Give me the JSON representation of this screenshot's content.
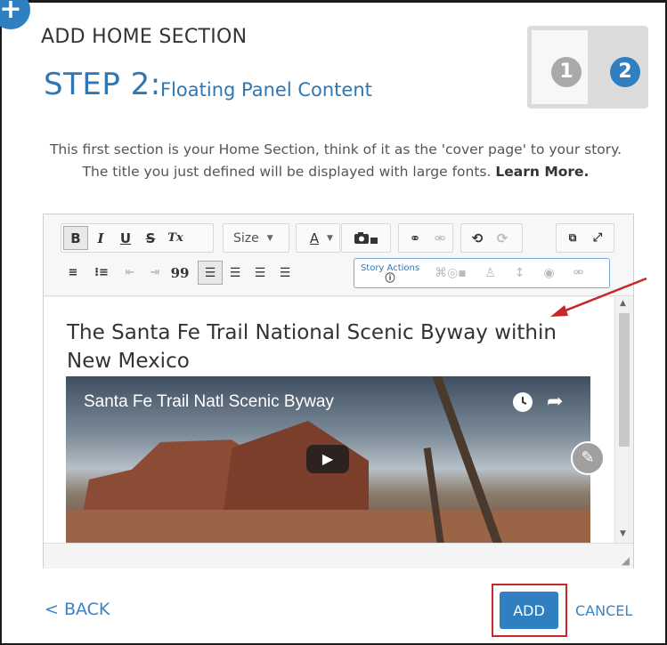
{
  "dialog": {
    "title": "ADD HOME SECTION",
    "corner_badge": "+",
    "step_label": "STEP 2:",
    "step_subtitle": "Floating Panel Content",
    "steps": [
      "1",
      "2"
    ],
    "current_step": 2
  },
  "intro": {
    "line1": "This first section is your Home Section, think of it as the 'cover page' to your story.",
    "line2": "The title you just defined will be displayed with large fonts.",
    "learn_more": "Learn More."
  },
  "toolbar": {
    "bold": "B",
    "italic": "I",
    "underline": "U",
    "strike": "S",
    "clear_format": "Tx",
    "size_label": "Size",
    "font_color": "A",
    "quote": "99",
    "story_actions_label": "Story Actions",
    "icons": {
      "media": "camera-icon",
      "link": "link-icon",
      "unlink": "unlink-icon",
      "undo": "undo-icon",
      "redo": "redo-icon",
      "source": "source-icon",
      "fullscreen": "fullscreen-icon"
    }
  },
  "content": {
    "heading": "The Santa Fe Trail National Scenic Byway within New Mexico",
    "video_title": "Santa Fe Trail Natl Scenic Byway"
  },
  "footer": {
    "back_label": "< BACK",
    "add_label": "ADD",
    "cancel_label": "CANCEL"
  },
  "colors": {
    "accent": "#2f7fc1",
    "highlight": "#c62828",
    "step_inactive": "#a9a9a9"
  }
}
